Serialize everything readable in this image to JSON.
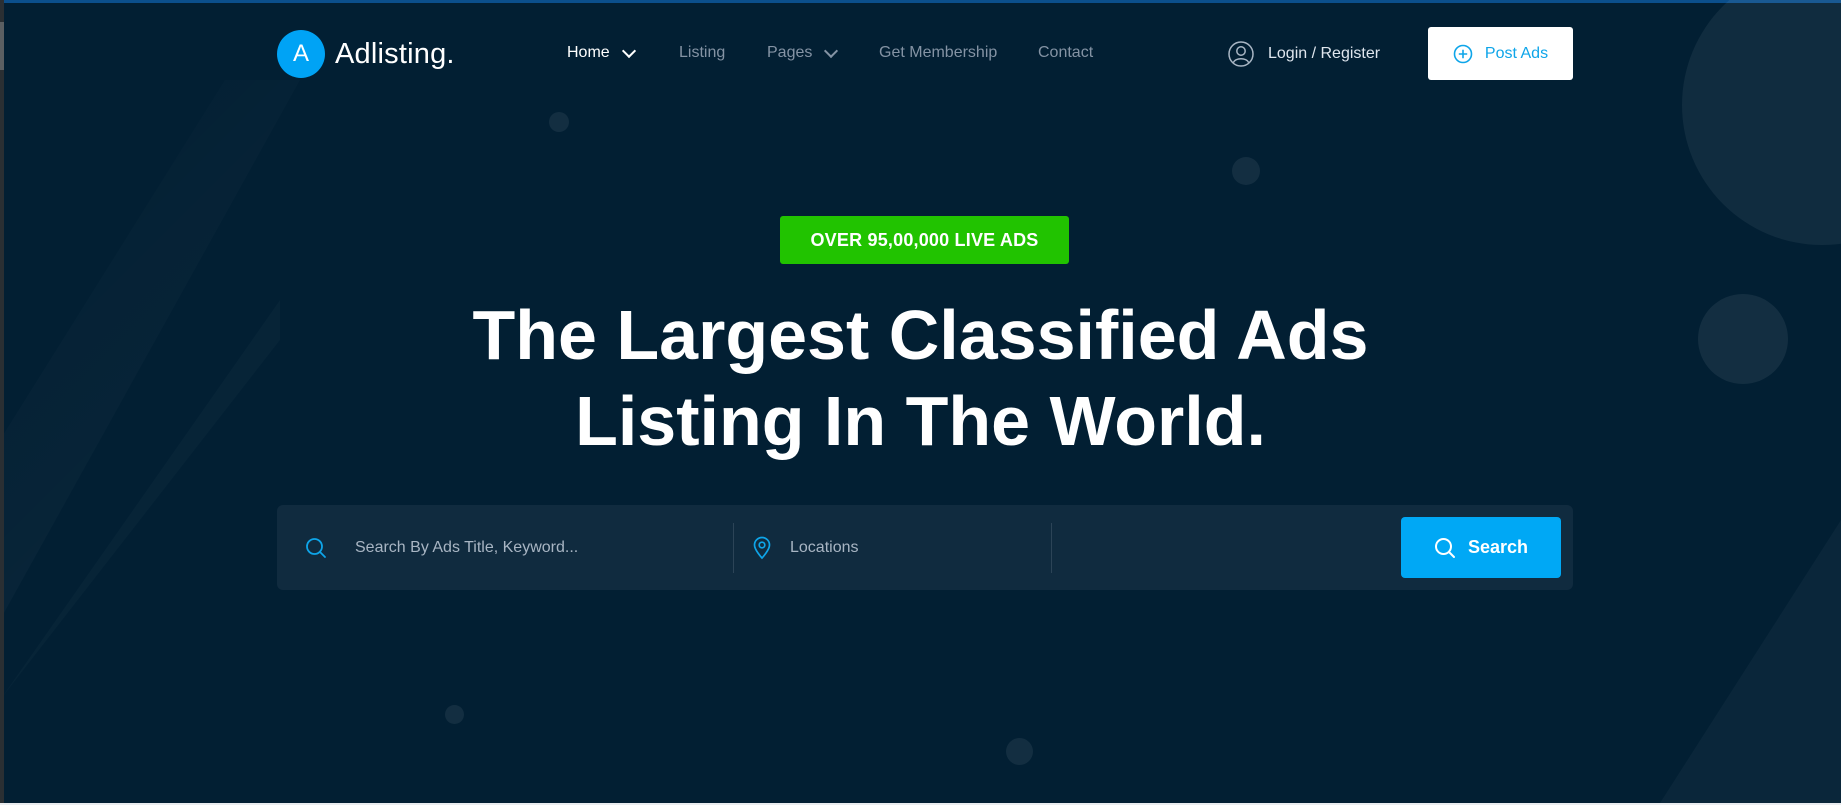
{
  "brand": {
    "logo_letter": "A",
    "name": "Adlisting.",
    "accent": "#00a3f5"
  },
  "nav": {
    "items": [
      {
        "label": "Home",
        "active": true,
        "dropdown": true
      },
      {
        "label": "Listing",
        "active": false,
        "dropdown": false
      },
      {
        "label": "Pages",
        "active": false,
        "dropdown": true
      },
      {
        "label": "Get Membership",
        "active": false,
        "dropdown": false
      },
      {
        "label": "Contact",
        "active": false,
        "dropdown": false
      }
    ]
  },
  "header": {
    "login_label": "Login / Register",
    "login_icon": "user-icon",
    "post_ads_label": "Post Ads",
    "post_ads_icon": "plus-circle-icon"
  },
  "hero": {
    "badge": "OVER 95,00,000 LIVE ADS",
    "badge_color": "#21c300",
    "headline_line1": "The Largest Classified Ads",
    "headline_line2": "Listing In The World."
  },
  "search": {
    "keyword_placeholder": "Search By Ads Title, Keyword...",
    "keyword_value": "",
    "location_placeholder": "Locations",
    "location_value": "",
    "button_label": "Search",
    "button_color": "#00a8f5"
  }
}
